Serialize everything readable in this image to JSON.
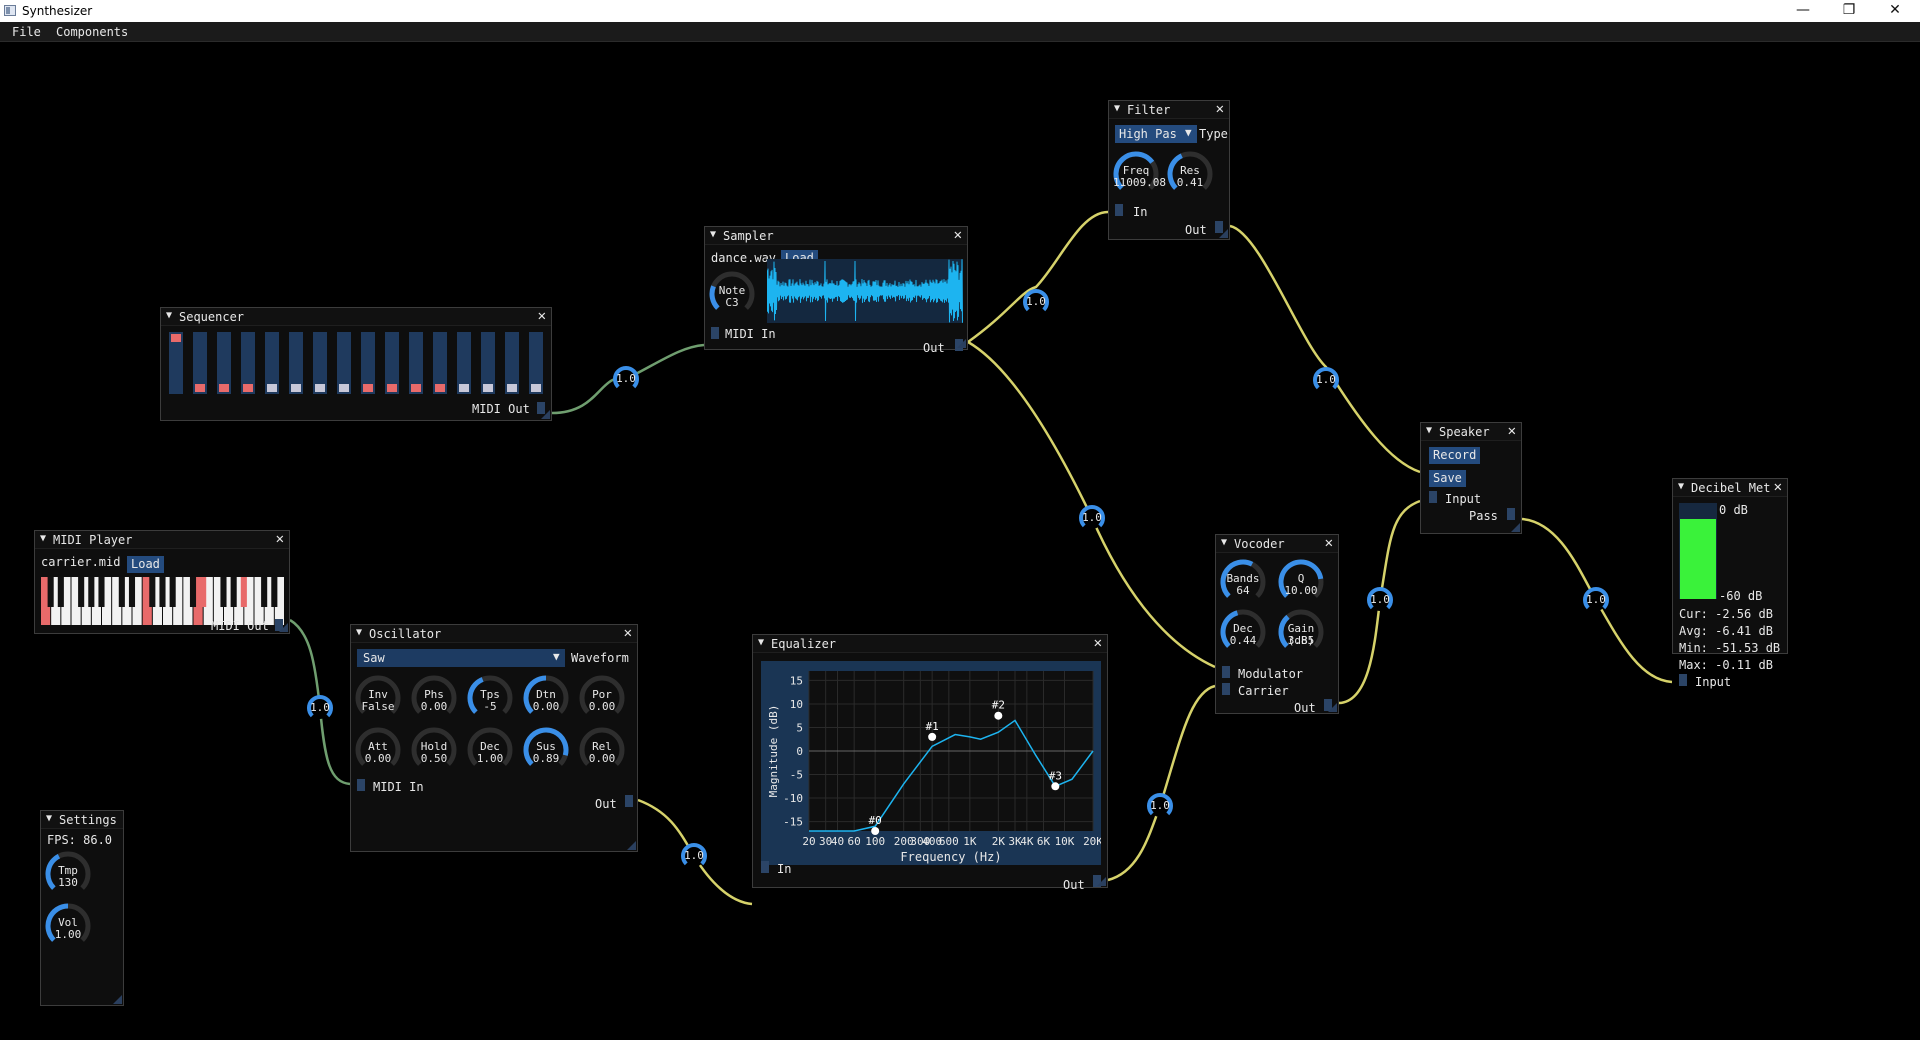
{
  "window": {
    "title": "Synthesizer",
    "min_glyph": "—",
    "max_glyph": "❐",
    "close_glyph": "✕"
  },
  "menu": {
    "file": "File",
    "components": "Components"
  },
  "colors": {
    "background": "#000000",
    "node_bg": "#0e0e0e",
    "accent": "#3a8fe8",
    "wire_audio": "#d6d26a",
    "wire_midi": "#6f9e6f",
    "meter": "#3af23a",
    "waveform": "#1db4f0",
    "key_active": "#e86a6a",
    "button": "#244b7e"
  },
  "common": {
    "close": "✕",
    "collapse": "▼",
    "wire_gain": "1.0"
  },
  "sequencer": {
    "title": "Sequencer",
    "midi_out": "MIDI Out"
  },
  "sampler": {
    "title": "Sampler",
    "file": "dance.wav",
    "load": "Load",
    "note_label": "Note",
    "note_value": "C3",
    "midi_in": "MIDI In",
    "out": "Out"
  },
  "filter": {
    "title": "Filter",
    "type_value": "High Pas",
    "type_label": "Type",
    "freq_label": "Freq",
    "freq_value": "11009.08",
    "res_label": "Res",
    "res_value": "0.41",
    "in": "In",
    "out": "Out"
  },
  "midi_player": {
    "title": "MIDI Player",
    "file": "carrier.mid",
    "load": "Load",
    "midi_out": "MIDI Out"
  },
  "oscillator": {
    "title": "Oscillator",
    "waveform_value": "Saw",
    "waveform_label": "Waveform",
    "knobs_row1": [
      {
        "label": "Inv",
        "value": "False"
      },
      {
        "label": "Phs",
        "value": "0.00"
      },
      {
        "label": "Tps",
        "value": "-5"
      },
      {
        "label": "Dtn",
        "value": "0.00"
      },
      {
        "label": "Por",
        "value": "0.00"
      }
    ],
    "knobs_row2": [
      {
        "label": "Att",
        "value": "0.00"
      },
      {
        "label": "Hold",
        "value": "0.50"
      },
      {
        "label": "Dec",
        "value": "1.00"
      },
      {
        "label": "Sus",
        "value": "0.89"
      },
      {
        "label": "Rel",
        "value": "0.00"
      }
    ],
    "midi_in": "MIDI In",
    "out": "Out"
  },
  "equalizer": {
    "title": "Equalizer",
    "ylabel": "Magnitude (dB)",
    "xlabel": "Frequency (Hz)",
    "y_ticks": [
      "15",
      "10",
      "5",
      "0",
      "-5",
      "-10",
      "-15"
    ],
    "x_ticks": [
      "20",
      "30",
      "40",
      "60",
      "100",
      "200",
      "300",
      "400",
      "600",
      "1K",
      "2K",
      "3K",
      "4K",
      "6K",
      "10K",
      "20K"
    ],
    "point_labels": [
      "#0",
      "#1",
      "#2",
      "#3"
    ],
    "in": "In",
    "out": "Out"
  },
  "vocoder": {
    "title": "Vocoder",
    "bands_label": "Bands",
    "bands_value": "64",
    "q_label": "Q",
    "q_value": "10.00",
    "dec_label": "Dec",
    "dec_value": "0.44",
    "gain_label": "Gain (dB)",
    "gain_value": "3.85",
    "modulator": "Modulator",
    "carrier": "Carrier",
    "out": "Out"
  },
  "speaker": {
    "title": "Speaker",
    "record": "Record",
    "save": "Save",
    "input": "Input",
    "pass": "Pass"
  },
  "decibel": {
    "title": "Decibel Met",
    "top_label": "0 dB",
    "bottom_label": "-60 dB",
    "cur": "Cur: -2.56 dB",
    "avg": "Avg: -6.41 dB",
    "min": "Min: -51.53 dB",
    "max": "Max: -0.11 dB",
    "input": "Input",
    "level_fraction": 0.85
  },
  "settings": {
    "title": "Settings",
    "fps": "FPS: 86.0",
    "tmp_label": "Tmp",
    "tmp_value": "130",
    "vol_label": "Vol",
    "vol_value": "1.00"
  },
  "chart_data": {
    "type": "line",
    "title": "",
    "xlabel": "Frequency (Hz)",
    "ylabel": "Magnitude (dB)",
    "x_scale": "log",
    "xlim": [
      20,
      20000
    ],
    "ylim": [
      -17,
      17
    ],
    "grid": true,
    "series": [
      {
        "x": [
          20,
          60,
          100,
          200,
          400,
          700,
          1000,
          1300,
          2000,
          3000,
          5000,
          8000,
          12000,
          20000
        ],
        "y": [
          -18,
          -17.5,
          -16,
          -7,
          1,
          3.5,
          3,
          2.5,
          4,
          6.5,
          -1,
          -7.5,
          -6,
          0
        ]
      }
    ],
    "points": [
      {
        "label": "#0",
        "x": 100,
        "y": -18
      },
      {
        "label": "#1",
        "x": 400,
        "y": 3
      },
      {
        "label": "#2",
        "x": 2000,
        "y": 7.5
      },
      {
        "label": "#3",
        "x": 8000,
        "y": -7.5
      }
    ]
  }
}
